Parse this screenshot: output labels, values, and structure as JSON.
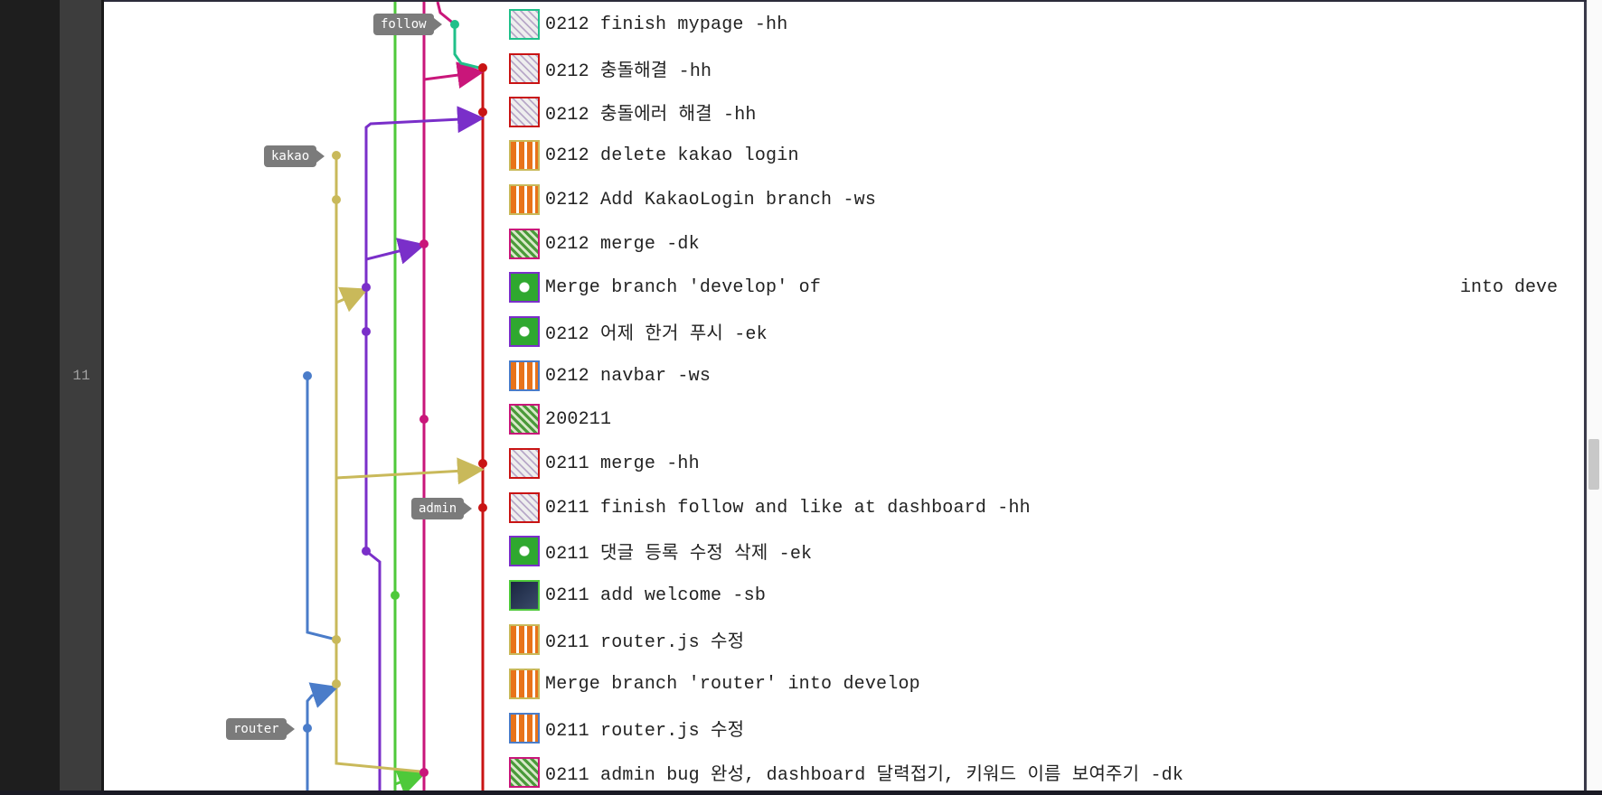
{
  "gutter": {
    "line_number": "11"
  },
  "branch_tags": {
    "follow": "follow",
    "kakao": "kakao",
    "admin": "admin",
    "router": "router"
  },
  "colors": {
    "lane_blue": "#4a7cc9",
    "lane_yellow": "#c9b95a",
    "lane_purple": "#7a2fc9",
    "lane_green": "#4ec93a",
    "lane_magenta": "#c9167a",
    "lane_red": "#c91414",
    "lane_teal": "#20c08a",
    "tag_bg": "#7b7b7b"
  },
  "commits": [
    {
      "message": "0212 finish mypage -hh",
      "avatar": "pink-quilt-avatar"
    },
    {
      "message": "0212 충돌해결 -hh",
      "avatar": "pink-quilt-avatar"
    },
    {
      "message": "0212 충돌에러 해결 -hh",
      "avatar": "pink-quilt-avatar"
    },
    {
      "message": "0212 delete kakao login",
      "avatar": "orange-quilt-avatar"
    },
    {
      "message": "0212 Add KakaoLogin branch -ws",
      "avatar": "orange-quilt-avatar"
    },
    {
      "message": "0212 merge -dk",
      "avatar": "green-quilt-avatar"
    },
    {
      "message": "Merge branch 'develop' of",
      "message_tail": "into deve",
      "avatar": "green-blue-quilt-avatar"
    },
    {
      "message": "0212 어제 한거 푸시 -ek",
      "avatar": "green-blue-quilt-avatar"
    },
    {
      "message": "0212 navbar -ws",
      "avatar": "orange-quilt-avatar"
    },
    {
      "message": "200211",
      "avatar": "green-quilt-avatar"
    },
    {
      "message": "0211 merge -hh",
      "avatar": "pink-quilt-avatar"
    },
    {
      "message": "0211 finish follow and like at dashboard -hh",
      "avatar": "pink-quilt-avatar"
    },
    {
      "message": "0211 댓글 등록 수정 삭제 -ek",
      "avatar": "green-blue-quilt-avatar"
    },
    {
      "message": "0211 add welcome -sb",
      "avatar": "dark-photo-avatar"
    },
    {
      "message": "0211 router.js 수정",
      "avatar": "orange-quilt-avatar"
    },
    {
      "message": "Merge branch 'router' into develop",
      "avatar": "orange-quilt-avatar"
    },
    {
      "message": "0211 router.js 수정",
      "avatar": "orange-quilt-avatar"
    },
    {
      "message": "0211 admin bug 완성, dashboard 달력접기, 키워드 이름 보여주기 -dk",
      "avatar": "green-quilt-avatar"
    }
  ]
}
